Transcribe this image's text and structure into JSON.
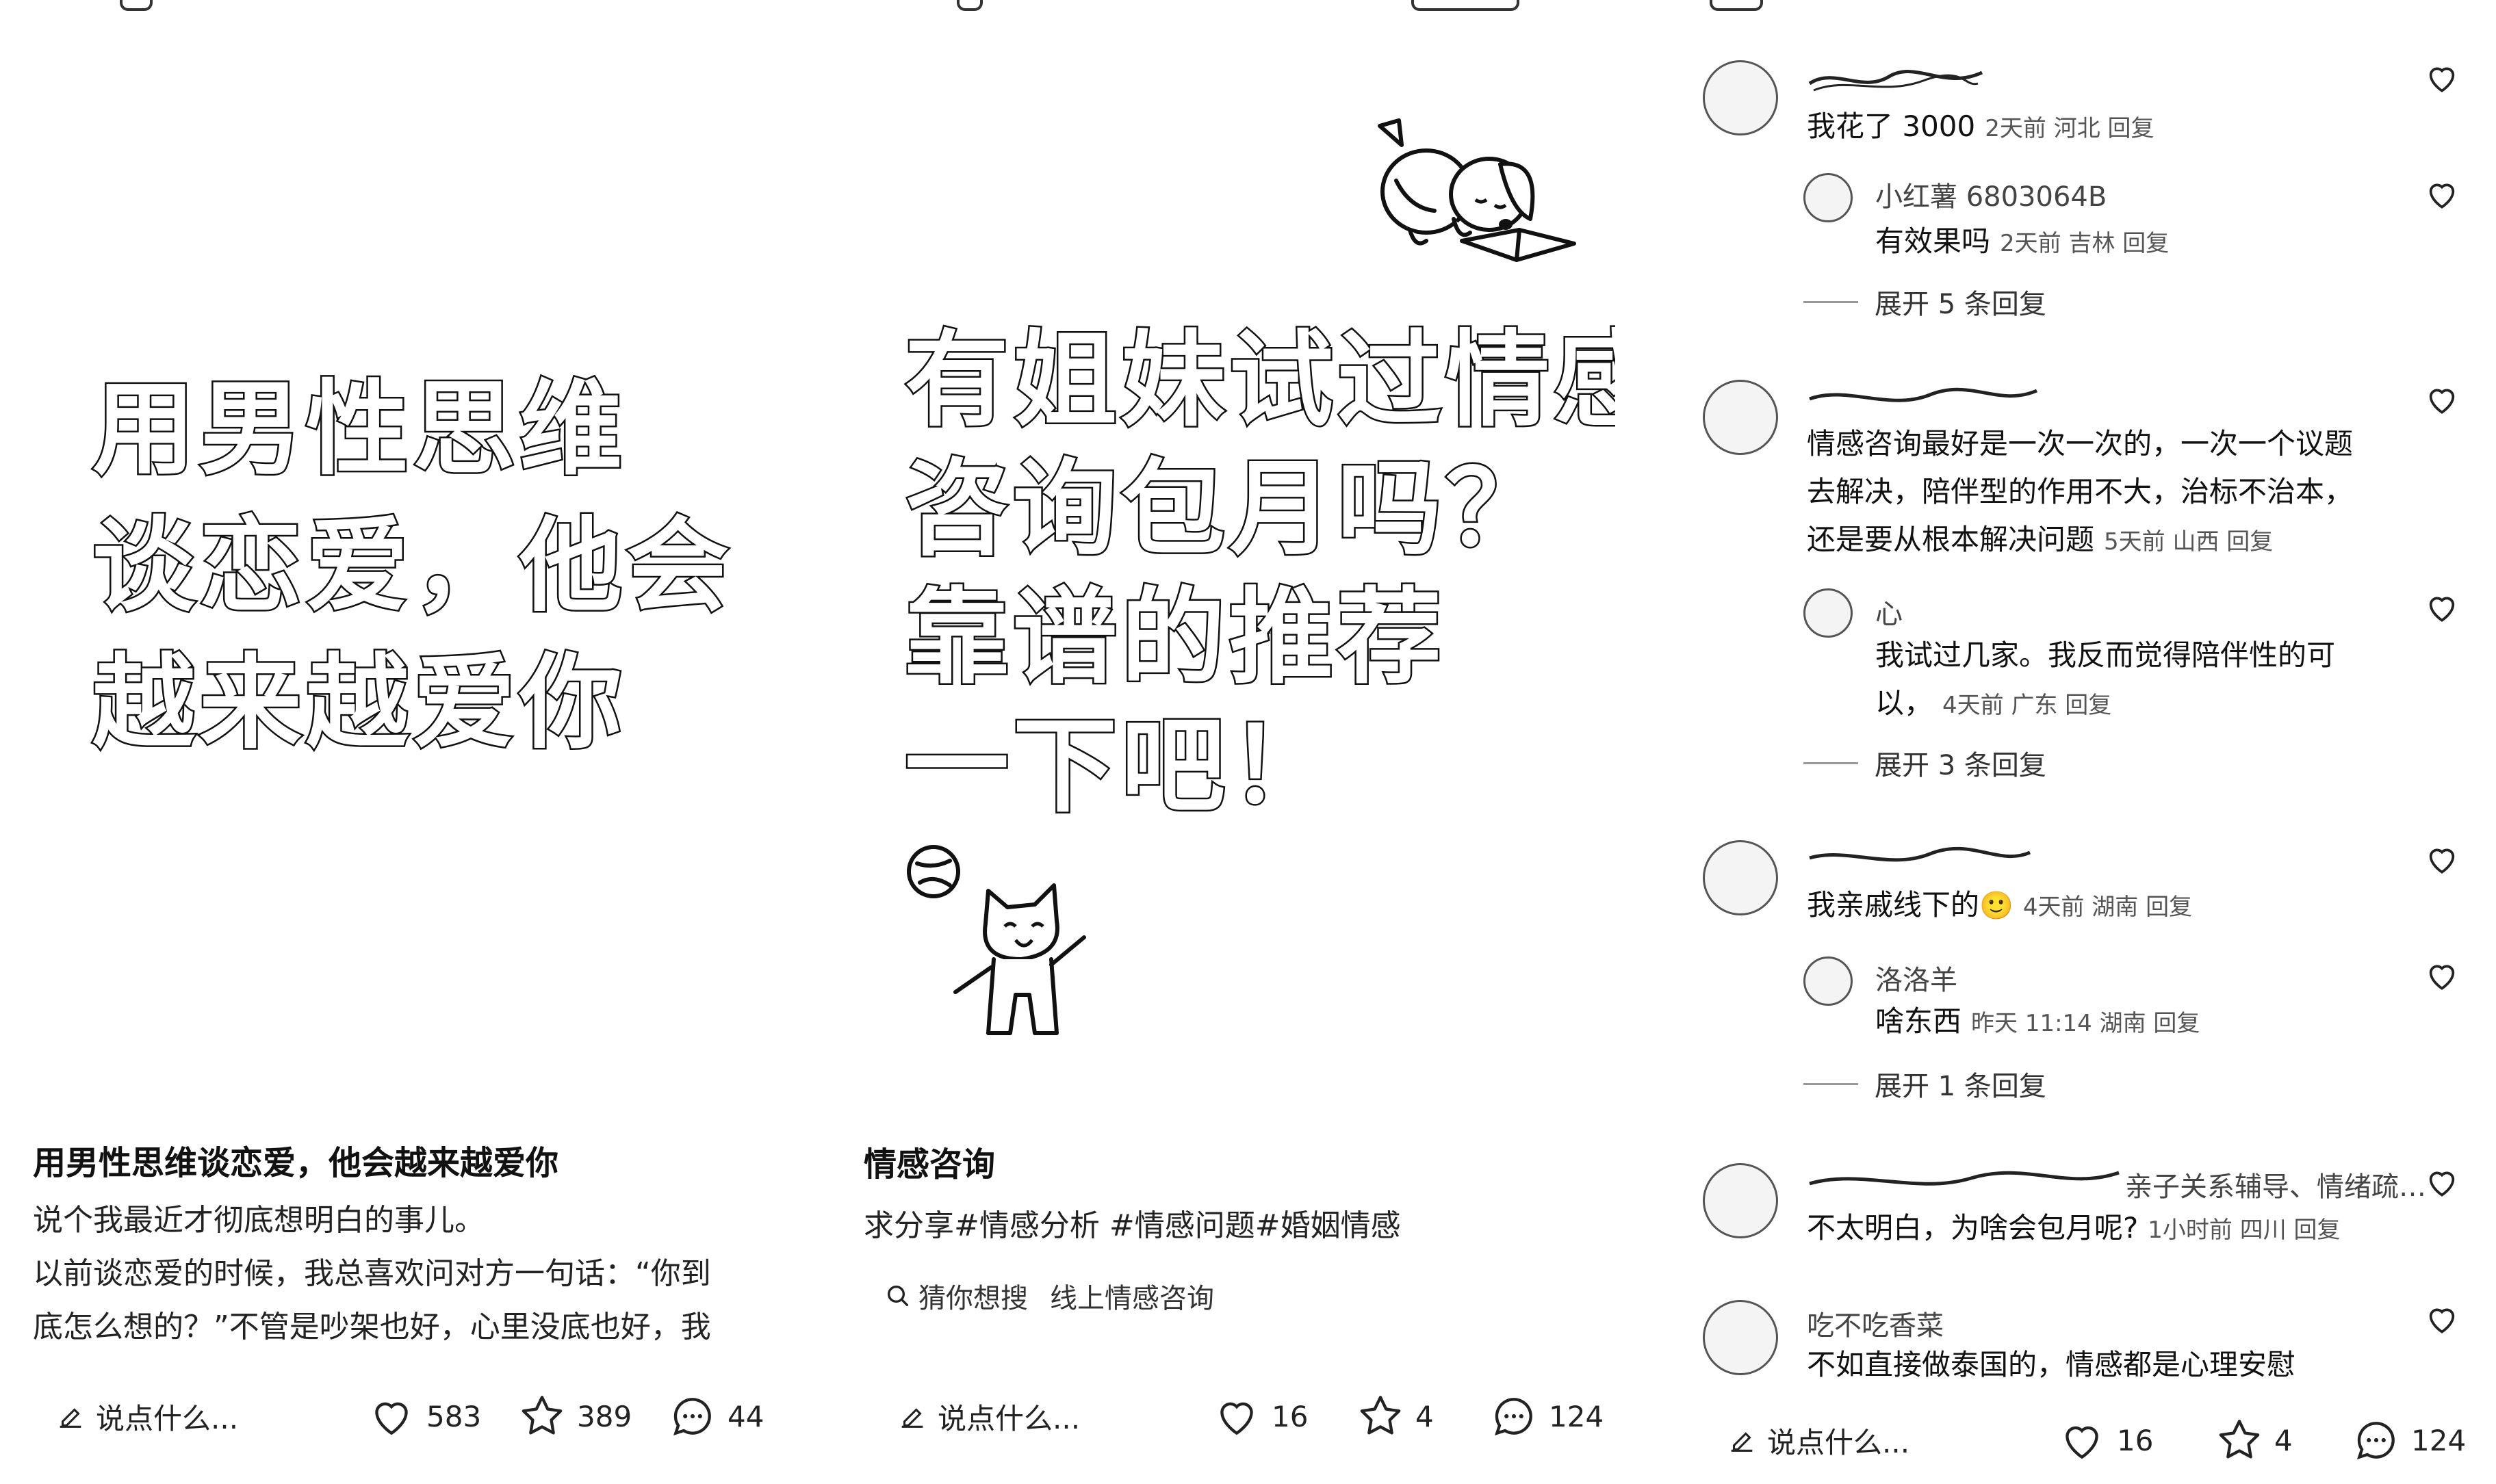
{
  "panel1": {
    "cover_lines": [
      "用男性思维",
      "谈恋爱，他会",
      "越来越爱你"
    ],
    "title": "用男性思维谈恋爱，他会越来越爱你",
    "body_lines": [
      "说个我最近才彻底想明白的事儿。",
      "以前谈恋爱的时候，我总喜欢问对方一句话：“你到",
      "底怎么想的？”不管是吵架也好，心里没底也好，我"
    ],
    "bar": {
      "say": "说点什么...",
      "likes": "583",
      "stars": "389",
      "comments": "44"
    }
  },
  "panel2": {
    "cover_lines": [
      "有姐妹试过情感",
      "咨询包月吗？",
      "靠谱的推荐",
      "一下吧！"
    ],
    "title": "情感咨询",
    "tags": "求分享#情感分析 #情感问题#婚姻情感",
    "guess_label": "猜你想搜",
    "guess_query": "线上情感咨询",
    "bar": {
      "say": "说点什么...",
      "likes": "16",
      "stars": "4",
      "comments": "124"
    }
  },
  "panel3": {
    "comments": [
      {
        "text": "我花了 3000",
        "meta": "2天前 河北 回复"
      },
      {
        "name": "小红薯 6803064B",
        "text": "有效果吗",
        "meta": "2天前 吉林 回复"
      },
      {
        "expand": "展开 5 条回复"
      },
      {
        "lines": [
          "情感咨询最好是一次一次的，一次一个议题",
          "去解决，陪伴型的作用不大，治标不治本，",
          "还是要从根本解决问题"
        ],
        "meta": "5天前 山西 回复"
      },
      {
        "name": "心",
        "lines": [
          "我试过几家。我反而觉得陪伴性的可",
          "以，"
        ],
        "meta": "4天前 广东 回复"
      },
      {
        "expand": "展开 3 条回复"
      },
      {
        "text": "我亲戚线下的",
        "meta": "4天前 湖南 回复"
      },
      {
        "name": "洛洛羊",
        "text": "啥东西",
        "meta": "昨天 11:14 湖南 回复"
      },
      {
        "expand": "展开 1 条回复"
      },
      {
        "name_partial": "亲子关系辅导、情绪疏…",
        "text": "不太明白，为啥会包月呢?",
        "meta": "1小时前 四川 回复"
      },
      {
        "name": "吃不吃香菜",
        "text": "不如直接做泰国的，情感都是心理安慰"
      }
    ],
    "bar": {
      "say": "说点什么...",
      "likes": "16",
      "stars": "4",
      "comments": "124"
    }
  },
  "icons": [
    "pencil-icon",
    "heart-icon",
    "star-icon",
    "comment-icon",
    "search-icon",
    "like-outline-icon"
  ]
}
